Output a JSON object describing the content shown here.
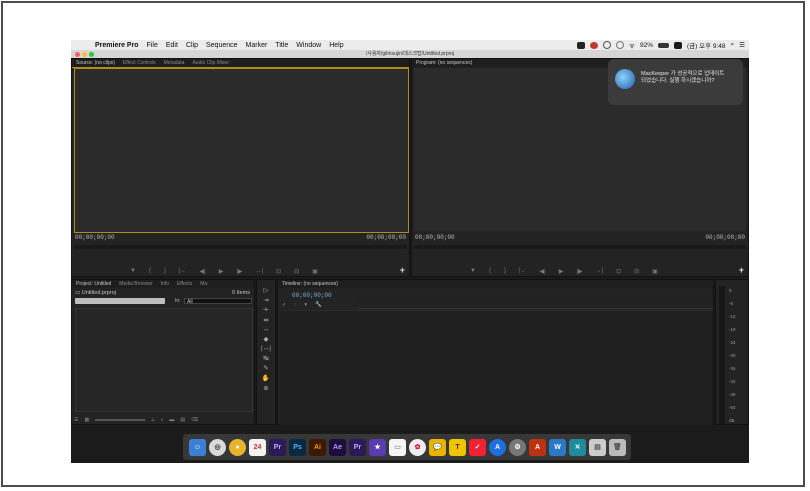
{
  "menubar": {
    "app_name": "Premiere Pro",
    "items": [
      "File",
      "Edit",
      "Clip",
      "Sequence",
      "Marker",
      "Title",
      "Window",
      "Help"
    ],
    "status_battery": "92%",
    "status_clock": "(금) 오후 9:48"
  },
  "window": {
    "title": "/사용자/gilmsujin/데스크탑/Untitled.prproj"
  },
  "source_panel": {
    "tabs": [
      "Source: (no clips)",
      "Effect Controls",
      "Metadata",
      "Audio Clip Mixer:"
    ],
    "timecode_left": "00;00;00;00",
    "timecode_right": "00;00;00;00"
  },
  "program_panel": {
    "tab": "Program: (no sequences)",
    "timecode_left": "00;00;00;00",
    "timecode_right": "00;00;00;00"
  },
  "project_panel": {
    "tabs": [
      "Project: Untitled",
      "Media Browser",
      "Info",
      "Effects",
      "Ma:"
    ],
    "file_name": "Untitled.prproj",
    "item_count": "0 Items",
    "in_label": "In:",
    "in_value": "All"
  },
  "timeline_panel": {
    "tab": "Timeline: (no sequences)",
    "timecode": "00;00;00;00"
  },
  "audio_meter": {
    "labels": [
      "0",
      "-6",
      "-12",
      "-18",
      "-24",
      "-30",
      "-36",
      "-42",
      "-48",
      "-54",
      "dB"
    ]
  },
  "notification": {
    "title": "MacKeeper 가 성공적으로 업데이트",
    "body": "되었습니다. 실행 하시겠습니까?"
  },
  "dock": {
    "items": [
      "Pr",
      "Ps",
      "Ai",
      "Ae",
      "Pr"
    ]
  }
}
